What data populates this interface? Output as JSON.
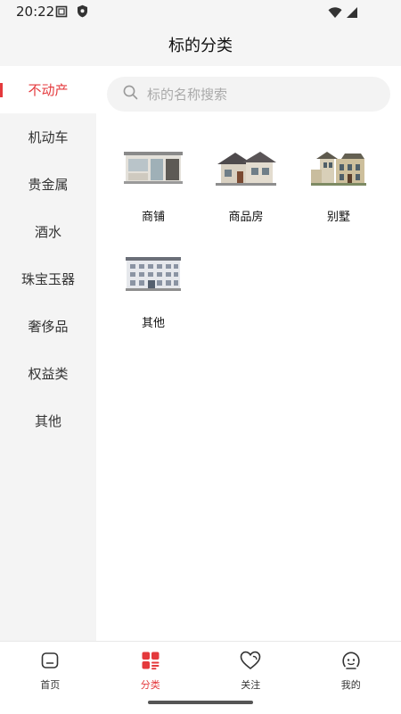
{
  "status_bar": {
    "time": "20:22"
  },
  "header": {
    "title": "标的分类"
  },
  "sidebar": {
    "items": [
      {
        "label": "不动产",
        "active": true
      },
      {
        "label": "机动车",
        "active": false
      },
      {
        "label": "贵金属",
        "active": false
      },
      {
        "label": "酒水",
        "active": false
      },
      {
        "label": "珠宝玉器",
        "active": false
      },
      {
        "label": "奢侈品",
        "active": false
      },
      {
        "label": "权益类",
        "active": false
      },
      {
        "label": "其他",
        "active": false
      }
    ]
  },
  "search": {
    "placeholder": "标的名称搜索"
  },
  "categories": [
    {
      "label": "商铺",
      "icon": "shop-building-icon"
    },
    {
      "label": "商品房",
      "icon": "house-icon"
    },
    {
      "label": "别墅",
      "icon": "villa-icon"
    },
    {
      "label": "其他",
      "icon": "office-building-icon"
    }
  ],
  "bottom_nav": {
    "items": [
      {
        "label": "首页",
        "icon": "home-icon",
        "active": false
      },
      {
        "label": "分类",
        "icon": "category-icon",
        "active": true
      },
      {
        "label": "关注",
        "icon": "heart-icon",
        "active": false
      },
      {
        "label": "我的",
        "icon": "profile-icon",
        "active": false
      }
    ]
  },
  "colors": {
    "accent": "#e4393c",
    "sidebar_bg": "#f4f4f4",
    "header_bg": "#f5f5f5"
  }
}
